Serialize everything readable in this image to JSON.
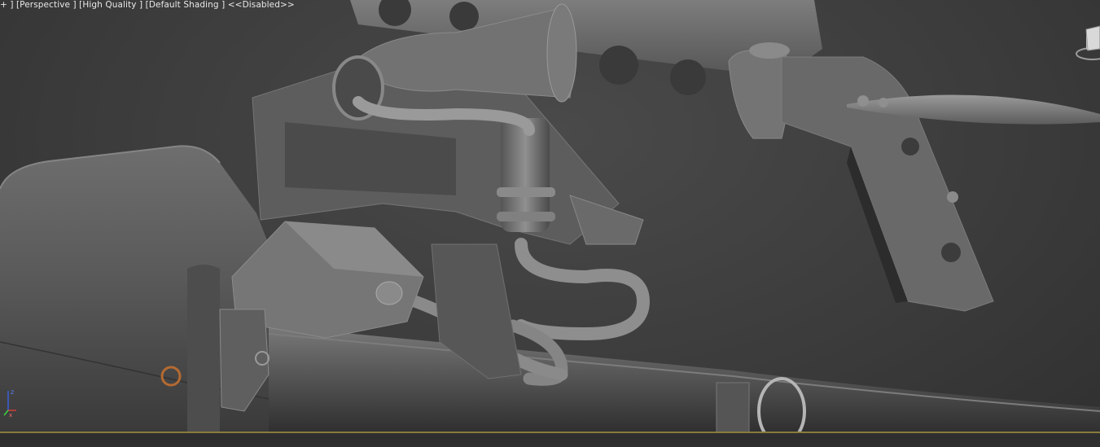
{
  "viewport": {
    "labels": {
      "plus": "+ ]",
      "view": "[Perspective ]",
      "quality": "[High Quality ]",
      "shading": "[Default Shading ]",
      "disabled": "<<Disabled>>"
    },
    "axis": {
      "z": "z",
      "x": "x"
    },
    "colors": {
      "background": "#3f3f3f",
      "active_border": "#8a7a3c",
      "model": "#6c6c6c"
    }
  }
}
